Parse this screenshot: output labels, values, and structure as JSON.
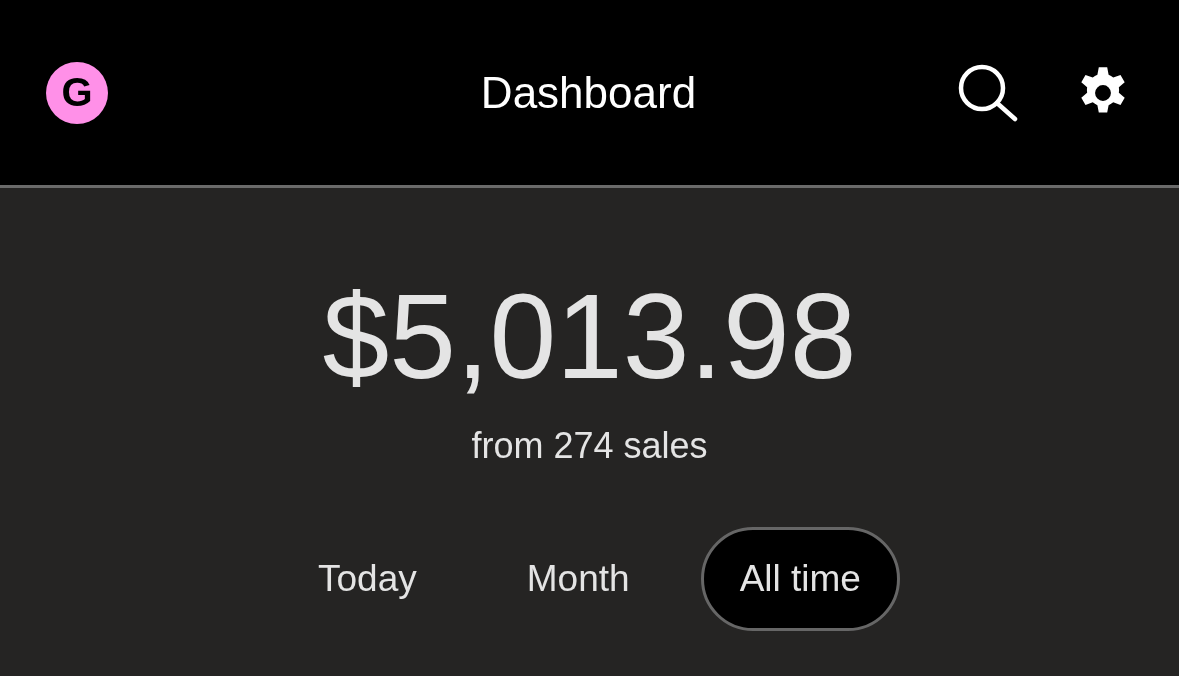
{
  "header": {
    "logo": "G",
    "title": "Dashboard"
  },
  "summary": {
    "amount": "$5,013.98",
    "caption": "from 274 sales"
  },
  "tabs": [
    {
      "label": "Today",
      "selected": false
    },
    {
      "label": "Month",
      "selected": false
    },
    {
      "label": "All time",
      "selected": true
    }
  ]
}
